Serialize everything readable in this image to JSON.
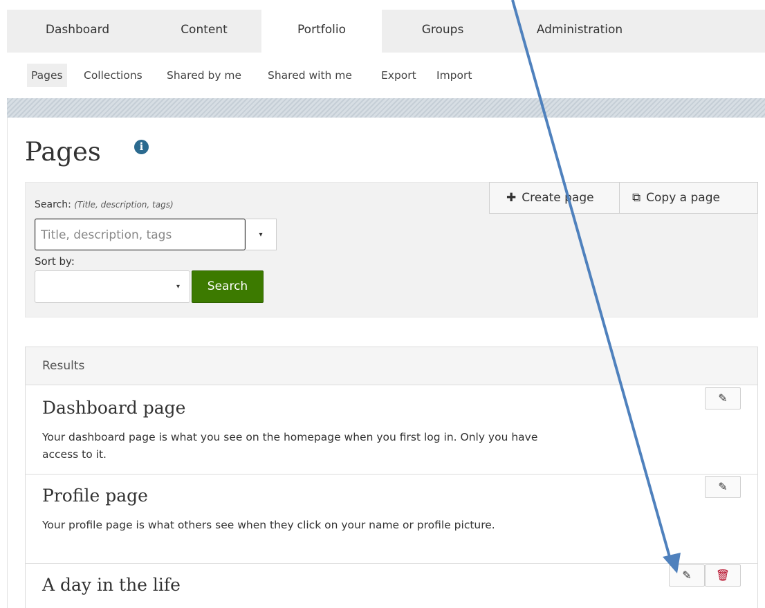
{
  "main_nav": {
    "tabs": [
      {
        "label": "Dashboard",
        "active": false
      },
      {
        "label": "Content",
        "active": false
      },
      {
        "label": "Portfolio",
        "active": true
      },
      {
        "label": "Groups",
        "active": false
      },
      {
        "label": "Administration",
        "active": false
      }
    ]
  },
  "sub_nav": {
    "items": [
      {
        "label": "Pages",
        "active": true
      },
      {
        "label": "Collections",
        "active": false
      },
      {
        "label": "Shared by me",
        "active": false
      },
      {
        "label": "Shared with me",
        "active": false
      },
      {
        "label": "Export",
        "active": false
      },
      {
        "label": "Import",
        "active": false
      }
    ]
  },
  "page": {
    "title": "Pages",
    "info_icon": "info-icon"
  },
  "actions": {
    "create_page": {
      "label": "Create page",
      "icon": "plus-icon"
    },
    "copy_page": {
      "label": "Copy a page",
      "icon": "copy-icon"
    }
  },
  "search": {
    "label": "Search:",
    "hint": "(Title, description, tags)",
    "placeholder": "Title, description, tags",
    "value": "",
    "dropdown_icon": "caret-down-icon",
    "sort_label": "Sort by:",
    "sort_value": "",
    "button_label": "Search",
    "button_color": "#3c7a00"
  },
  "results": {
    "heading": "Results",
    "items": [
      {
        "title": "Dashboard page",
        "description": "Your dashboard page is what you see on the homepage when you first log in. Only you have access to it.",
        "buttons": [
          "edit"
        ]
      },
      {
        "title": "Profile page",
        "description": "Your profile page is what others see when they click on your name or profile picture.",
        "buttons": [
          "edit"
        ]
      },
      {
        "title": "A day in the life",
        "description": "",
        "buttons": [
          "edit",
          "delete"
        ]
      }
    ]
  },
  "glyphs": {
    "edit": "✎",
    "delete": "🗑",
    "plus": "✚",
    "copy": "⧉",
    "caret": "▾",
    "info": "i"
  },
  "colors": {
    "nav_bg": "#eeeeee",
    "search_button": "#3c7a00",
    "info_icon": "#2b6a8f",
    "delete_icon": "#b3001e",
    "annotation_arrow": "#4f81bd"
  }
}
